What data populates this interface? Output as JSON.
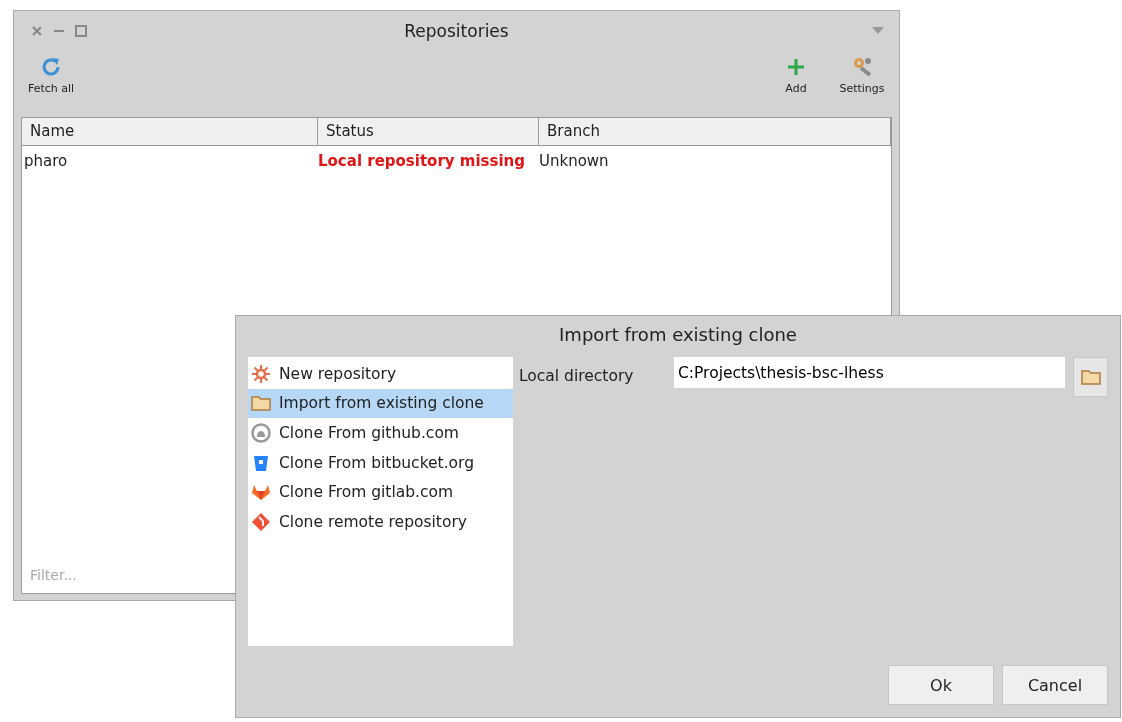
{
  "repositories_window": {
    "title": "Repositories",
    "toolbar_left": [
      {
        "label": "Fetch all",
        "kind": "refresh"
      }
    ],
    "toolbar_right": [
      {
        "label": "Add",
        "kind": "add"
      },
      {
        "label": "Settings",
        "kind": "settings"
      }
    ],
    "table": {
      "columns": [
        "Name",
        "Status",
        "Branch"
      ],
      "rows": [
        {
          "name": "pharo",
          "status": "Local repository missing",
          "status_error": true,
          "branch": "Unknown"
        }
      ]
    },
    "filter": {
      "placeholder": "Filter..."
    }
  },
  "import_dialog": {
    "title": "Import from existing clone",
    "sources": [
      {
        "label": "New repository",
        "kind": "new",
        "selected": false
      },
      {
        "label": "Import from existing clone",
        "kind": "folder",
        "selected": true
      },
      {
        "label": "Clone From github.com",
        "kind": "github",
        "selected": false
      },
      {
        "label": "Clone From bitbucket.org",
        "kind": "bitbucket",
        "selected": false
      },
      {
        "label": "Clone From gitlab.com",
        "kind": "gitlab",
        "selected": false
      },
      {
        "label": "Clone remote repository",
        "kind": "git",
        "selected": false
      }
    ],
    "local_directory": {
      "label": "Local directory",
      "value": "C:Projects\\thesis-bsc-lhess"
    },
    "buttons": [
      "Ok",
      "Cancel"
    ]
  }
}
